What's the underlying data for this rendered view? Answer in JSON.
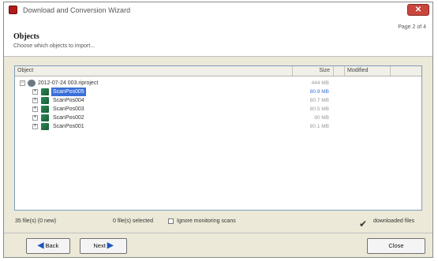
{
  "window": {
    "title": "Download and Conversion Wizard"
  },
  "header": {
    "title": "Objects",
    "subtitle": "Choose which objects to import...",
    "page_indicator": "Page 2 of 4"
  },
  "list": {
    "columns": [
      {
        "label": "Object"
      },
      {
        "label": "Size"
      },
      {
        "label": ""
      },
      {
        "label": "Modified"
      }
    ],
    "project": {
      "name": "2012-07-24 003.riproject",
      "size": "444 MB"
    },
    "scans": [
      {
        "name": "ScanPos005",
        "size": "80.9 MB",
        "selected": true
      },
      {
        "name": "ScanPos004",
        "size": "80.7 MB",
        "selected": false
      },
      {
        "name": "ScanPos003",
        "size": "80.5 MB",
        "selected": false
      },
      {
        "name": "ScanPos002",
        "size": "90 MB",
        "selected": false
      },
      {
        "name": "ScanPos001",
        "size": "80.1 MB",
        "selected": false
      }
    ]
  },
  "status": {
    "files_count": "35 file(s) (0 new)",
    "files_selected": "0 file(s) selected",
    "ignore_label": "Ignore monitoring scans",
    "downloaded_label": "downloaded files"
  },
  "buttons": {
    "back": "Back",
    "next": "Next",
    "close": "Close"
  },
  "colors": {
    "selection": "#3a6fd8",
    "title_icon": "#b41a1a",
    "close_button": "#c9463d"
  }
}
